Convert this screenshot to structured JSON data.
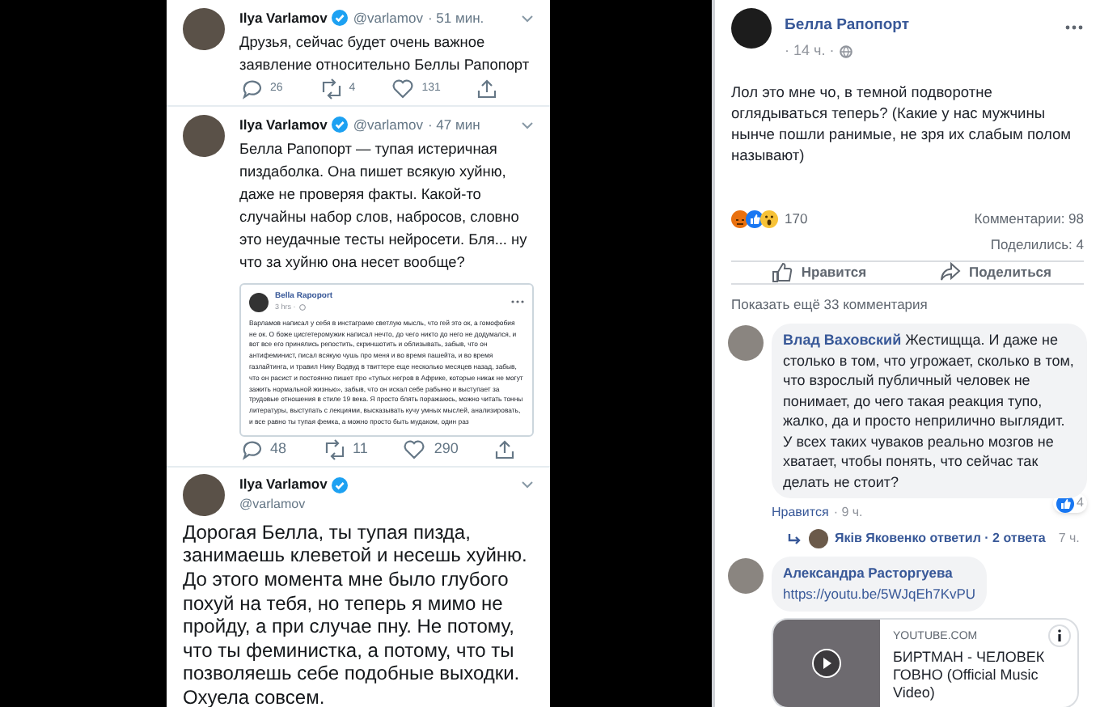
{
  "twitter": {
    "tweets": [
      {
        "author": "Ilya Varlamov",
        "handle": "@varlamov",
        "time": "· 51 мин.",
        "text": "Друзья, сейчас будет очень важное заявление относительно Беллы Рапопорт",
        "replies": "26",
        "retweets": "4",
        "likes": "131"
      },
      {
        "author": "Ilya Varlamov",
        "handle": "@varlamov",
        "time": "· 47 мин",
        "text": "Белла Рапопорт — тупая истеричная пиздаболка. Она пишет всякую хуйню, даже не проверяя факты. Какой-то случайны набор слов, набросов, словно это неудачные тесты нейросети. Бля... ну что за хуйню она несет вообще?",
        "embed": {
          "author": "Bella Rapoport",
          "time": "3 hrs ·",
          "text": "Варламов написал у себя в инстаграме светлую мысль, что гей это ок, а гомофобия не ок. О боже цисгетеромужик написал нечто, до чего никто до него не додумался, и вот все его принялись репостить, скриншотить и облизывать, забыв, что он антифеминист, писал всякую чушь про меня и во время пашейта, и во время газлайтинга, и травил Нику Водвуд в твиттере еще несколько месяцев назад, забыв, что он расист и постоянно пишет про «тупых негров в Африке, которые никак не могут зажить нормальной жизнью», забыв, что он искал себе рабыню и выступает за трудовые отношения в стиле 19 века. Я просто блять поражаюсь, можно читать тонны литературы, выступать с лекциями, высказывать кучу умных мыслей, анализировать, и все равно ты тупая фемка, а можно просто быть мудаком, один раз"
        },
        "replies": "48",
        "retweets": "11",
        "likes": "290"
      }
    ],
    "main_tweet": {
      "author": "Ilya Varlamov",
      "handle": "@varlamov",
      "text": "Дорогая Белла, ты тупая пизда, занимаешь клеветой и несешь хуйню. До этого момента мне было глубого похуй на тебя, но теперь я мимо не пройду, а при случае пну. Не потому, что ты феминистка, а потому, что ты позволяешь себе подобные выходки. Охуела совсем."
    }
  },
  "facebook": {
    "post": {
      "author": "Белла Рапопорт",
      "time": "· 14 ч. ·",
      "text": "Лол это мне чо, в темной подворотне оглядываться теперь? (Какие у нас мужчины нынче пошли ранимые, не зря их слабым полом называют)",
      "reactions_count": "170",
      "comments": "Комментарии: 98",
      "shares": "Поделились: 4",
      "actions": [
        {
          "kind": "like",
          "label": "Нравится"
        },
        {
          "kind": "share",
          "label": "Поделиться"
        }
      ]
    },
    "more_comments": "Показать ещё 33 комментария",
    "comments": [
      {
        "author": "Влад Ваховский",
        "text": "Жестищща. И даже не столько в том, что угрожает, сколько в том, что взрослый публичный человек не понимает, до чего такая реакция тупо, жалко, да и просто неприлично выглядит. У всех таких чуваков реально мозгов не хватает, чтобы понять, что сейчас так делать не стоит?",
        "like_action": "Нравится",
        "time": "· 9 ч.",
        "likes": "4",
        "reply_summary": {
          "text": "Яків Яковенко ответил · 2 ответа",
          "time": "7 ч."
        }
      },
      {
        "author": "Александра Расторгуева",
        "text": "https://youtu.be/5WJqEh7KvPU",
        "link_preview": {
          "source": "YOUTUBE.COM",
          "title": "БИРТМАН - ЧЕЛОВЕК ГОВНО (Official Music Video)"
        }
      }
    ]
  }
}
